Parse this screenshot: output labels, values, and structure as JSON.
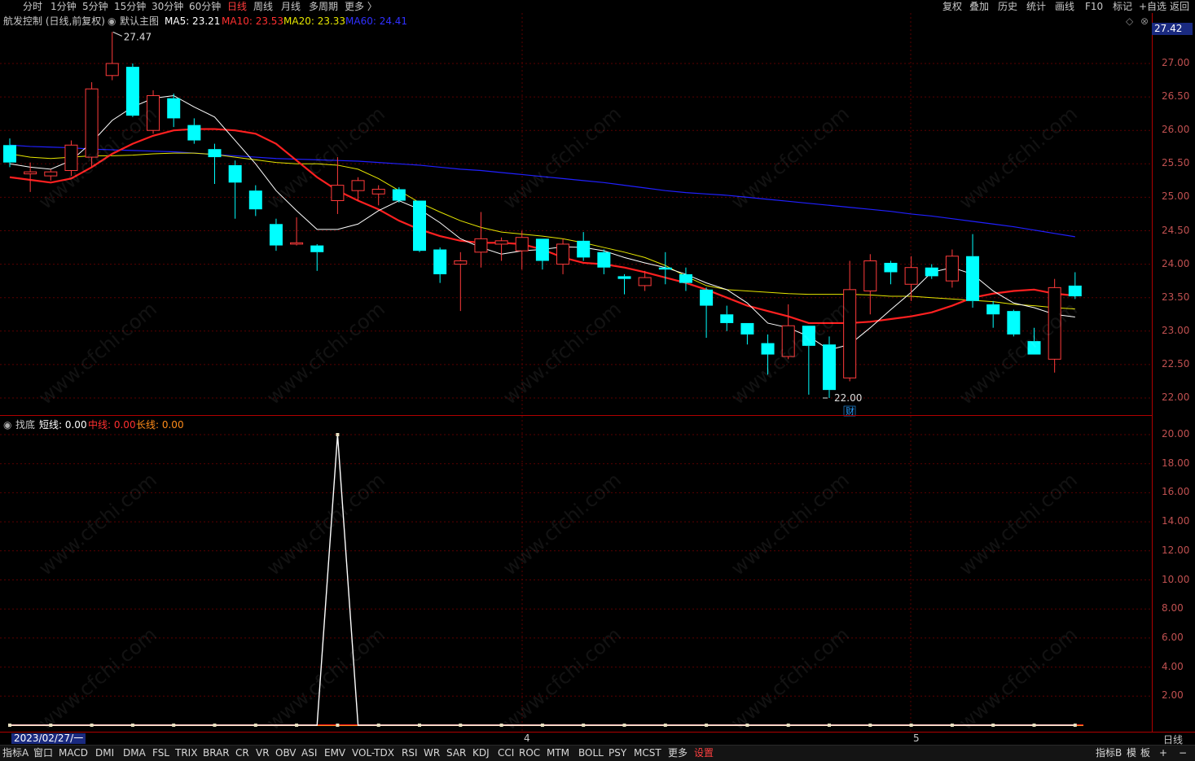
{
  "top_bar": {
    "left": [
      "分时",
      "1分钟",
      "5分钟",
      "15分钟",
      "30分钟",
      "60分钟",
      "日线",
      "周线",
      "月线",
      "多周期",
      "更多 〉"
    ],
    "active": "日线",
    "right": [
      "复权",
      "叠加",
      "历史",
      "统计",
      "画线",
      "F10",
      "标记",
      "+自选",
      "返回"
    ]
  },
  "main_info": {
    "title": "航发控制 (日线,前复权)",
    "indicator_name": "默认主图",
    "ma5": "MA5: 23.21",
    "ma10": "MA10: 23.53",
    "ma20": "MA20: 23.33",
    "ma60": "MA60: 24.41"
  },
  "sub_info": {
    "name": "找底",
    "short": "短线: 0.00",
    "mid": "中线: 0.00",
    "long": "长线: 0.00"
  },
  "current_price": "27.42",
  "price_axis": [
    "27.00",
    "26.50",
    "26.00",
    "25.50",
    "25.00",
    "24.50",
    "24.00",
    "23.50",
    "23.00",
    "22.50",
    "22.00"
  ],
  "indicator_axis": [
    "20.00",
    "18.00",
    "16.00",
    "14.00",
    "12.00",
    "10.00",
    "8.00",
    "6.00",
    "4.00",
    "2.00"
  ],
  "high_label": "27.47",
  "low_label": "22.00",
  "event_marker": "财",
  "date_cursor": "2023/02/27/一",
  "months": [
    "4",
    "5"
  ],
  "period": "日线",
  "watermark": "www.cfchi.com",
  "bottom_tabs": {
    "left": [
      "指标A",
      "窗口",
      "MACD",
      "DMI",
      "DMA",
      "FSL",
      "TRIX",
      "BRAR",
      "CR",
      "VR",
      "OBV",
      "ASI",
      "EMV",
      "VOL-TDX",
      "RSI",
      "WR",
      "SAR",
      "KDJ",
      "CCI",
      "ROC",
      "MTM",
      "BOLL",
      "PSY",
      "MCST",
      "更多",
      "设置"
    ],
    "right": [
      "指标B",
      "模",
      "板",
      "+",
      "−"
    ]
  },
  "colors": {
    "up": "#ff3b3b",
    "down": "#00ffff",
    "ma5": "#ffffff",
    "ma10": "#ff2020",
    "ma20": "#e6e600",
    "ma60": "#2020ff",
    "axis": "#b00000"
  },
  "chart_data": {
    "type": "candlestick",
    "candles": [
      {
        "o": 25.78,
        "h": 25.88,
        "l": 25.45,
        "c": 25.52
      },
      {
        "o": 25.35,
        "h": 25.52,
        "l": 25.08,
        "c": 25.38
      },
      {
        "o": 25.32,
        "h": 25.42,
        "l": 25.25,
        "c": 25.38
      },
      {
        "o": 25.4,
        "h": 25.85,
        "l": 25.32,
        "c": 25.78
      },
      {
        "o": 25.6,
        "h": 26.72,
        "l": 25.45,
        "c": 26.62
      },
      {
        "o": 26.82,
        "h": 27.47,
        "l": 26.75,
        "c": 27.0
      },
      {
        "o": 26.95,
        "h": 27.0,
        "l": 26.2,
        "c": 26.22
      },
      {
        "o": 26.0,
        "h": 26.6,
        "l": 25.95,
        "c": 26.52
      },
      {
        "o": 26.48,
        "h": 26.55,
        "l": 26.05,
        "c": 26.18
      },
      {
        "o": 26.08,
        "h": 26.18,
        "l": 25.8,
        "c": 25.85
      },
      {
        "o": 25.72,
        "h": 25.8,
        "l": 25.2,
        "c": 25.6
      },
      {
        "o": 25.48,
        "h": 25.55,
        "l": 24.68,
        "c": 25.22
      },
      {
        "o": 25.1,
        "h": 25.18,
        "l": 24.72,
        "c": 24.82
      },
      {
        "o": 24.6,
        "h": 24.68,
        "l": 24.2,
        "c": 24.28
      },
      {
        "o": 24.3,
        "h": 24.7,
        "l": 24.28,
        "c": 24.32
      },
      {
        "o": 24.28,
        "h": 24.3,
        "l": 23.9,
        "c": 24.18
      },
      {
        "o": 24.95,
        "h": 25.6,
        "l": 24.75,
        "c": 25.18
      },
      {
        "o": 25.1,
        "h": 25.3,
        "l": 24.95,
        "c": 25.25
      },
      {
        "o": 25.05,
        "h": 25.18,
        "l": 24.88,
        "c": 25.12
      },
      {
        "o": 25.12,
        "h": 25.15,
        "l": 24.92,
        "c": 24.95
      },
      {
        "o": 24.95,
        "h": 24.95,
        "l": 24.18,
        "c": 24.2
      },
      {
        "o": 24.22,
        "h": 24.25,
        "l": 23.72,
        "c": 23.85
      },
      {
        "o": 24.0,
        "h": 24.18,
        "l": 23.3,
        "c": 24.05
      },
      {
        "o": 24.18,
        "h": 24.78,
        "l": 23.95,
        "c": 24.38
      },
      {
        "o": 24.3,
        "h": 24.4,
        "l": 24.05,
        "c": 24.35
      },
      {
        "o": 24.2,
        "h": 24.5,
        "l": 23.92,
        "c": 24.4
      },
      {
        "o": 24.38,
        "h": 24.38,
        "l": 23.92,
        "c": 24.05
      },
      {
        "o": 24.0,
        "h": 24.38,
        "l": 23.85,
        "c": 24.3
      },
      {
        "o": 24.35,
        "h": 24.48,
        "l": 24.05,
        "c": 24.1
      },
      {
        "o": 24.18,
        "h": 24.22,
        "l": 23.85,
        "c": 23.95
      },
      {
        "o": 23.82,
        "h": 23.85,
        "l": 23.55,
        "c": 23.78
      },
      {
        "o": 23.68,
        "h": 23.9,
        "l": 23.6,
        "c": 23.8
      },
      {
        "o": 23.95,
        "h": 24.18,
        "l": 23.7,
        "c": 23.92
      },
      {
        "o": 23.85,
        "h": 23.95,
        "l": 23.6,
        "c": 23.72
      },
      {
        "o": 23.62,
        "h": 23.65,
        "l": 22.9,
        "c": 23.38
      },
      {
        "o": 23.25,
        "h": 23.38,
        "l": 23.0,
        "c": 23.12
      },
      {
        "o": 23.12,
        "h": 23.12,
        "l": 22.8,
        "c": 22.95
      },
      {
        "o": 22.82,
        "h": 22.95,
        "l": 22.35,
        "c": 22.65
      },
      {
        "o": 22.62,
        "h": 23.4,
        "l": 22.58,
        "c": 23.08
      },
      {
        "o": 23.08,
        "h": 23.08,
        "l": 22.05,
        "c": 22.78
      },
      {
        "o": 22.8,
        "h": 22.92,
        "l": 22.0,
        "c": 22.12
      },
      {
        "o": 22.3,
        "h": 24.05,
        "l": 22.25,
        "c": 23.62
      },
      {
        "o": 23.6,
        "h": 24.15,
        "l": 23.25,
        "c": 24.05
      },
      {
        "o": 24.02,
        "h": 24.05,
        "l": 23.7,
        "c": 23.88
      },
      {
        "o": 23.7,
        "h": 24.12,
        "l": 23.45,
        "c": 23.95
      },
      {
        "o": 23.95,
        "h": 24.0,
        "l": 23.78,
        "c": 23.82
      },
      {
        "o": 23.75,
        "h": 24.22,
        "l": 23.65,
        "c": 24.12
      },
      {
        "o": 24.12,
        "h": 24.45,
        "l": 23.35,
        "c": 23.45
      },
      {
        "o": 23.4,
        "h": 23.45,
        "l": 23.05,
        "c": 23.25
      },
      {
        "o": 23.3,
        "h": 23.32,
        "l": 22.92,
        "c": 22.95
      },
      {
        "o": 22.85,
        "h": 23.05,
        "l": 22.65,
        "c": 22.65
      },
      {
        "o": 22.58,
        "h": 23.78,
        "l": 22.38,
        "c": 23.65
      },
      {
        "o": 23.68,
        "h": 23.88,
        "l": 23.48,
        "c": 23.52
      }
    ],
    "ma5": [
      25.5,
      25.45,
      25.42,
      25.55,
      25.82,
      26.15,
      26.35,
      26.48,
      26.52,
      26.35,
      26.2,
      25.85,
      25.5,
      25.1,
      24.8,
      24.52,
      24.52,
      24.6,
      24.8,
      24.95,
      24.82,
      24.62,
      24.38,
      24.25,
      24.15,
      24.2,
      24.22,
      24.26,
      24.25,
      24.2,
      24.1,
      24.02,
      23.95,
      23.85,
      23.72,
      23.62,
      23.42,
      23.12,
      23.05,
      22.92,
      22.72,
      22.8,
      23.05,
      23.32,
      23.58,
      23.88,
      23.95,
      23.85,
      23.6,
      23.42,
      23.35,
      23.25,
      23.21
    ],
    "ma10": [
      25.3,
      25.26,
      25.22,
      25.28,
      25.45,
      25.65,
      25.8,
      25.92,
      26.0,
      26.02,
      26.02,
      26.0,
      25.95,
      25.8,
      25.55,
      25.3,
      25.1,
      24.95,
      24.82,
      24.65,
      24.52,
      24.42,
      24.35,
      24.32,
      24.32,
      24.3,
      24.22,
      24.1,
      24.02,
      24.0,
      23.95,
      23.88,
      23.8,
      23.72,
      23.62,
      23.5,
      23.38,
      23.3,
      23.22,
      23.12,
      23.12,
      23.12,
      23.14,
      23.18,
      23.22,
      23.28,
      23.38,
      23.5,
      23.56,
      23.6,
      23.62,
      23.56,
      23.53
    ],
    "ma20": [
      25.65,
      25.6,
      25.58,
      25.6,
      25.62,
      25.62,
      25.63,
      25.65,
      25.66,
      25.66,
      25.64,
      25.6,
      25.56,
      25.52,
      25.5,
      25.5,
      25.48,
      25.42,
      25.28,
      25.1,
      24.92,
      24.78,
      24.65,
      24.55,
      24.48,
      24.45,
      24.42,
      24.38,
      24.32,
      24.25,
      24.18,
      24.1,
      23.98,
      23.82,
      23.68,
      23.62,
      23.6,
      23.58,
      23.56,
      23.55,
      23.55,
      23.55,
      23.54,
      23.52,
      23.52,
      23.5,
      23.48,
      23.46,
      23.44,
      23.4,
      23.38,
      23.35,
      23.33
    ],
    "ma60": [
      25.78,
      25.76,
      25.75,
      25.74,
      25.72,
      25.71,
      25.7,
      25.69,
      25.68,
      25.66,
      25.64,
      25.62,
      25.6,
      25.58,
      25.57,
      25.56,
      25.55,
      25.54,
      25.52,
      25.5,
      25.48,
      25.45,
      25.42,
      25.4,
      25.37,
      25.34,
      25.31,
      25.28,
      25.25,
      25.22,
      25.18,
      25.14,
      25.1,
      25.07,
      25.05,
      25.03,
      25.0,
      24.97,
      24.94,
      24.91,
      24.88,
      24.85,
      24.82,
      24.79,
      24.75,
      24.72,
      24.68,
      24.64,
      24.6,
      24.56,
      24.51,
      24.46,
      24.41
    ],
    "indicator": {
      "name": "找底",
      "values": [
        0,
        0,
        0,
        0,
        0,
        0,
        0,
        0,
        0,
        0,
        0,
        0,
        0,
        0,
        0,
        0,
        20,
        0,
        0,
        0,
        0,
        0,
        0,
        0,
        0,
        0,
        0,
        0,
        0,
        0,
        0,
        0,
        0,
        0,
        0,
        0,
        0,
        0,
        0,
        0,
        0,
        0,
        0,
        0,
        0,
        0,
        0,
        0,
        0,
        0,
        0,
        0,
        0
      ]
    }
  }
}
